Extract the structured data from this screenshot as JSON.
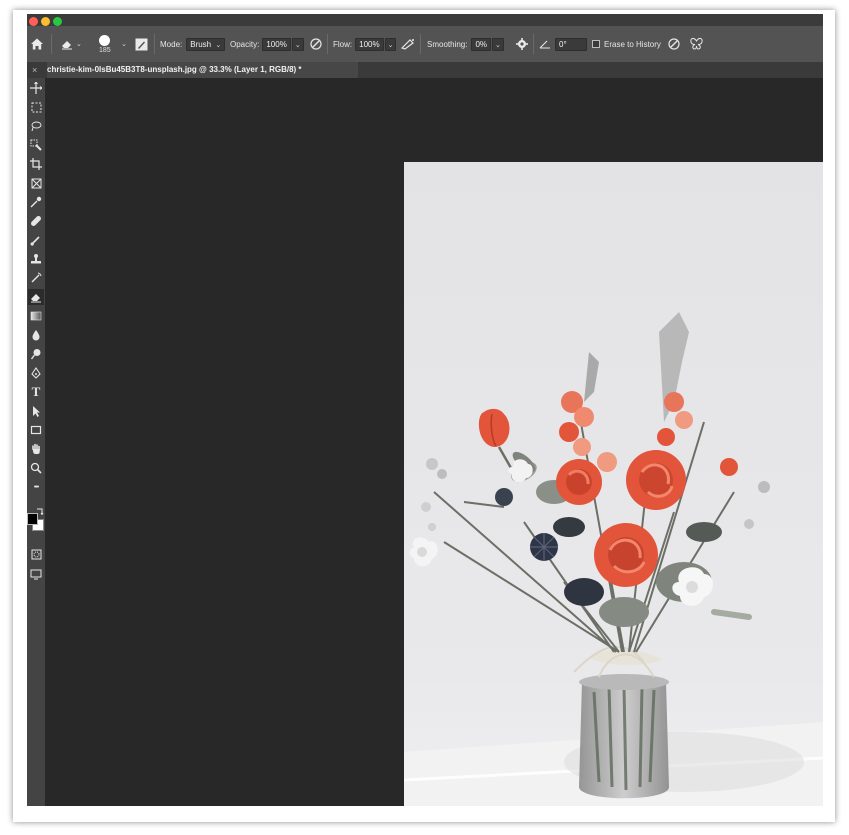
{
  "options_bar": {
    "brush_size": "185",
    "mode_label": "Mode:",
    "mode_value": "Brush",
    "opacity_label": "Opacity:",
    "opacity_value": "100%",
    "flow_label": "Flow:",
    "flow_value": "100%",
    "smoothing_label": "Smoothing:",
    "smoothing_value": "0%",
    "angle_value": "0°",
    "erase_to_history_label": "Erase to History",
    "erase_to_history_checked": false
  },
  "document": {
    "tab_title": "christie-kim-0IsBu45B3T8-unsplash.jpg @ 33.3% (Layer 1, RGB/8) *",
    "close_glyph": "×"
  },
  "tools": [
    "move-tool-icon",
    "marquee-tool-icon",
    "lasso-tool-icon",
    "quick-selection-tool-icon",
    "crop-tool-icon",
    "frame-tool-icon",
    "eyedropper-tool-icon",
    "healing-brush-tool-icon",
    "brush-tool-icon",
    "clone-stamp-tool-icon",
    "history-brush-tool-icon",
    "eraser-tool-icon",
    "gradient-tool-icon",
    "blur-tool-icon",
    "dodge-tool-icon",
    "pen-tool-icon",
    "type-tool-icon",
    "path-selection-tool-icon",
    "rectangle-tool-icon",
    "hand-tool-icon",
    "zoom-tool-icon",
    "more-tools-icon"
  ],
  "toolbar_text": {
    "type_glyph": "T",
    "more_glyph": "•••"
  },
  "colors": {
    "foreground": "#000000",
    "background": "#ffffff",
    "ui_dark": "#282828",
    "options_bar": "#535353",
    "toolbar": "#444444",
    "flower_accent": "#e2553a"
  }
}
